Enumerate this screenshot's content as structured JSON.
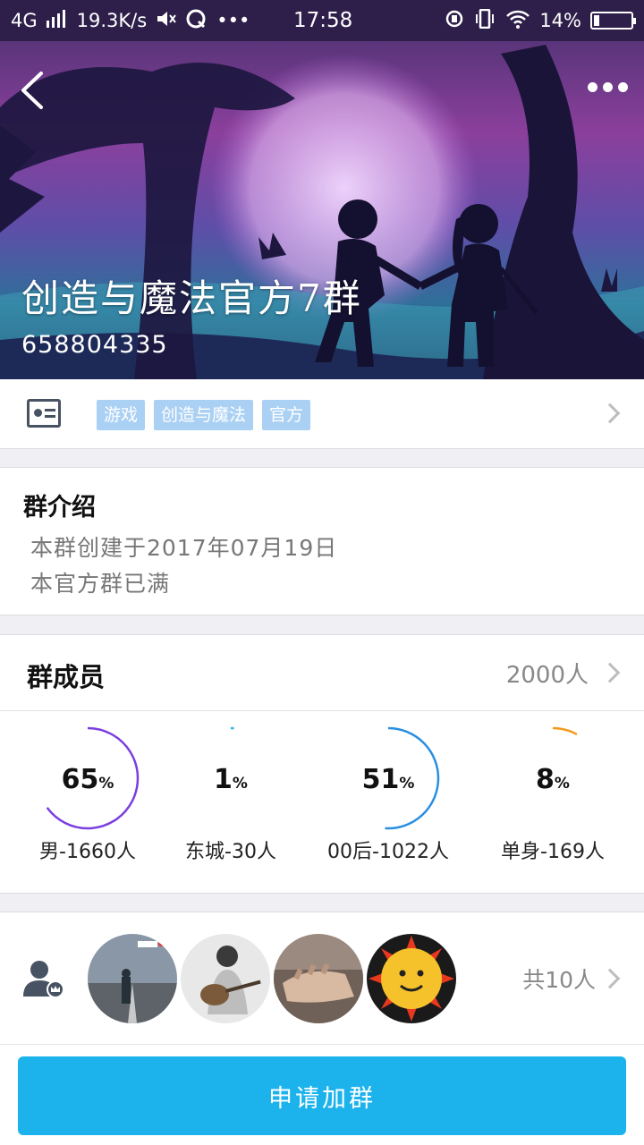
{
  "status_bar": {
    "network": "4G",
    "speed": "19.3K/s",
    "time": "17:58",
    "battery": "14%",
    "battery_level": 0.14
  },
  "hero": {
    "group_name": "创造与魔法官方7群",
    "group_id": "658804335"
  },
  "tags": [
    "游戏",
    "创造与魔法",
    "官方"
  ],
  "intro": {
    "heading": "群介绍",
    "lines": [
      "本群创建于2017年07月19日",
      "本官方群已满"
    ]
  },
  "members": {
    "heading": "群成员",
    "count": "2000人",
    "stats": [
      {
        "percent": 65,
        "pct_text": "65",
        "unit": "%",
        "label": "男-1660人",
        "color": "#7b3fe0"
      },
      {
        "percent": 1,
        "pct_text": "1",
        "unit": "%",
        "label": "东城-30人",
        "color": "#29b6e8"
      },
      {
        "percent": 51,
        "pct_text": "51",
        "unit": "%",
        "label": "00后-1022人",
        "color": "#2a8fe0"
      },
      {
        "percent": 8,
        "pct_text": "8",
        "unit": "%",
        "label": "单身-169人",
        "color": "#f39a1e"
      }
    ]
  },
  "avatars": {
    "total": "共10人"
  },
  "join_button": "申请加群"
}
